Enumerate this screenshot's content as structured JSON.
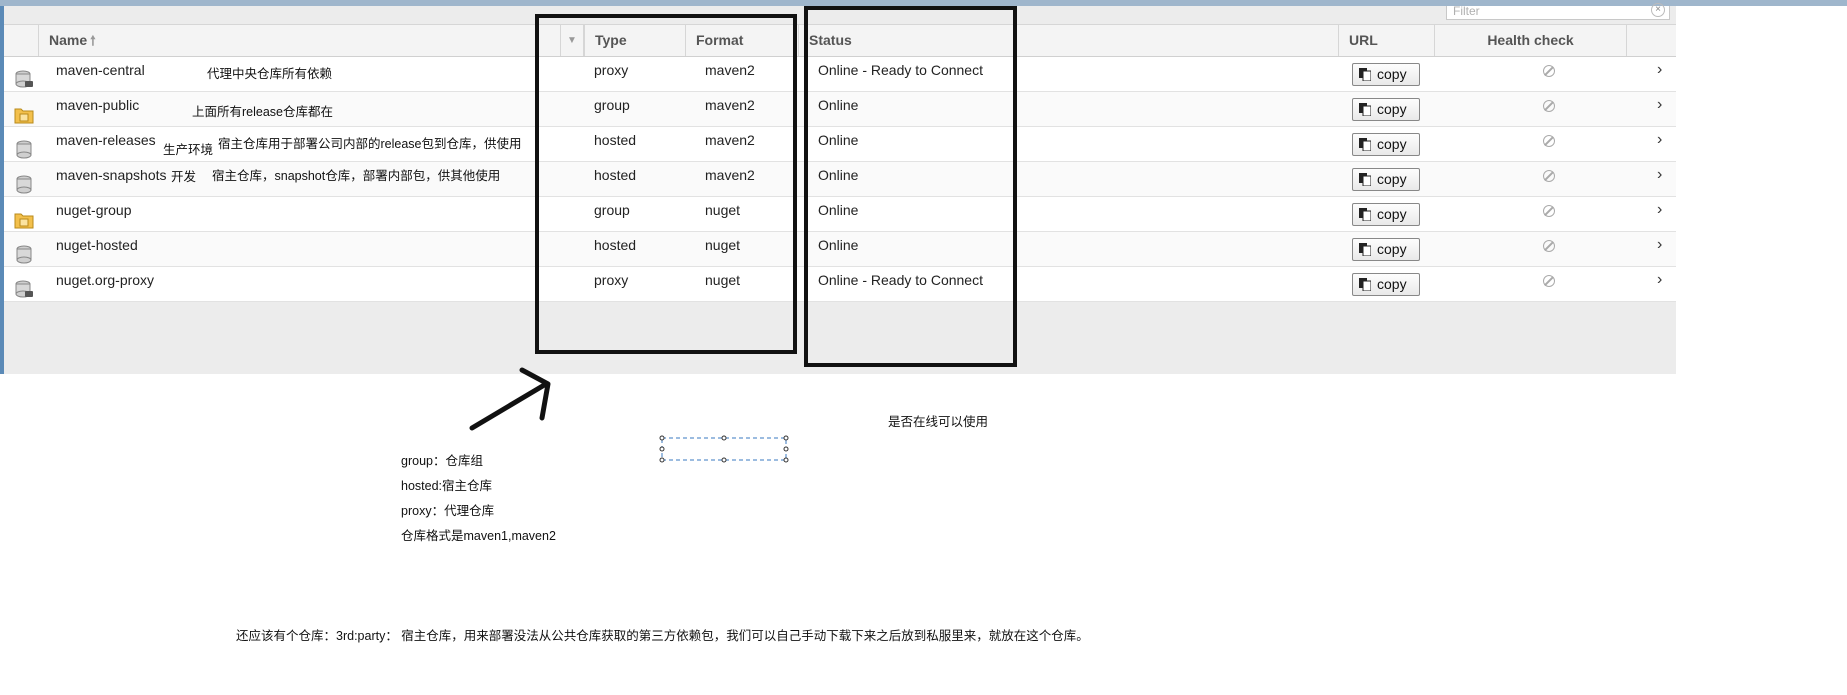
{
  "filter": {
    "placeholder": "Filter",
    "clear_glyph": "×"
  },
  "header": {
    "name": "Name",
    "sort_glyph": "🠕",
    "menu_glyph": "▼",
    "type": "Type",
    "format": "Format",
    "status": "Status",
    "url": "URL",
    "health": "Health check"
  },
  "rows": [
    {
      "icon": "proxy-repo-icon",
      "name": "maven-central",
      "type": "proxy",
      "format": "maven2",
      "status": "Online - Ready to Connect",
      "copy": "copy"
    },
    {
      "icon": "group-repo-icon",
      "name": "maven-public",
      "type": "group",
      "format": "maven2",
      "status": "Online",
      "copy": "copy"
    },
    {
      "icon": "hosted-repo-icon",
      "name": "maven-releases",
      "type": "hosted",
      "format": "maven2",
      "status": "Online",
      "copy": "copy"
    },
    {
      "icon": "hosted-repo-icon",
      "name": "maven-snapshots",
      "type": "hosted",
      "format": "maven2",
      "status": "Online",
      "copy": "copy"
    },
    {
      "icon": "group-repo-icon",
      "name": "nuget-group",
      "type": "group",
      "format": "nuget",
      "status": "Online",
      "copy": "copy"
    },
    {
      "icon": "hosted-repo-icon",
      "name": "nuget-hosted",
      "type": "hosted",
      "format": "nuget",
      "status": "Online",
      "copy": "copy"
    },
    {
      "icon": "proxy-repo-icon",
      "name": "nuget.org-proxy",
      "type": "proxy",
      "format": "nuget",
      "status": "Online - Ready to Connect",
      "copy": "copy"
    }
  ],
  "annotations": {
    "central": "代理中央仓库所有依赖",
    "public": "上面所有release仓库都在",
    "releases_env": "生产环境",
    "releases": "宿主仓库用于部署公司内部的release包到仓库，供使用",
    "snapshots_env": "开发",
    "snapshots": "宿主仓库，snapshot仓库，部署内部包，供其他使用",
    "online": "是否在线可以使用",
    "legend": [
      "group：仓库组",
      "hosted:宿主仓库",
      "proxy：代理仓库",
      "仓库格式是maven1,maven2"
    ],
    "footer": "还应该有个仓库：3rd:party： 宿主仓库，用来部署没法从公共仓库获取的第三方依赖包，我们可以自己手动下载下来之后放到私服里来，就放在这个仓库。"
  },
  "colors": {
    "highlight_box": "#111111",
    "grid_bg": "#ececec",
    "selection_dashes": "#3a78c2"
  }
}
